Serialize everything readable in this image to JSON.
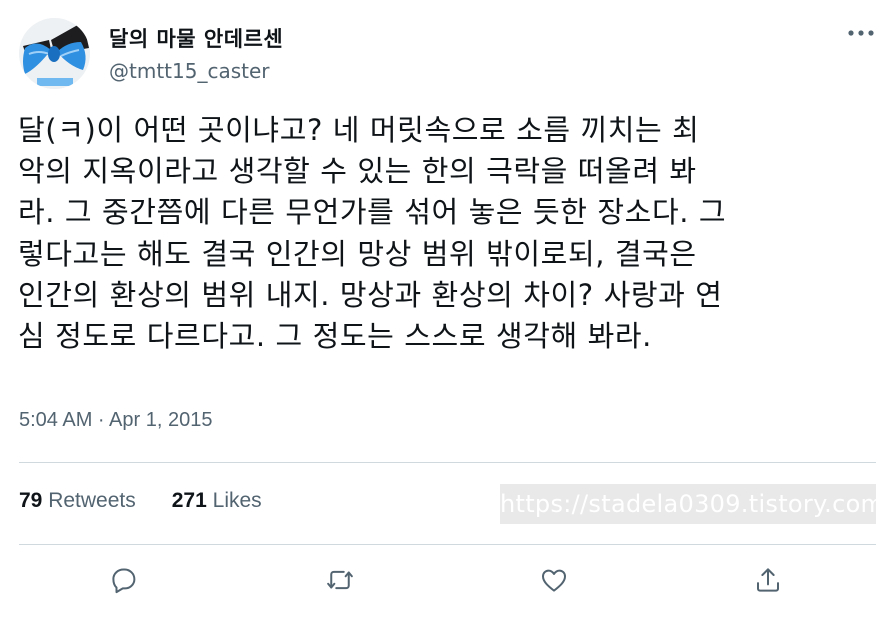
{
  "user": {
    "display_name": "달의 마물 안데르센",
    "handle": "@tmtt15_caster"
  },
  "tweet": {
    "lines": [
      "달(ㅋ)이 어떤 곳이냐고? 네 머릿속으로 소름 끼치는 최",
      "악의 지옥이라고 생각할 수 있는 한의 극락을 떠올려 봐",
      "라. 그 중간쯤에 다른 무언가를 섞어 놓은 듯한 장소다. 그",
      "렇다고는 해도 결국 인간의 망상 범위 밖이로되, 결국은",
      "인간의 환상의 범위 내지. 망상과 환상의 차이? 사랑과 연",
      "심 정도로 다르다고. 그 정도는 스스로 생각해 봐라."
    ],
    "timestamp": "5:04 AM · Apr 1, 2015"
  },
  "stats": {
    "retweets_count": "79",
    "retweets_label": "Retweets",
    "likes_count": "271",
    "likes_label": "Likes"
  },
  "watermark": "https://stadela0309.tistory.com",
  "icons": {
    "more": "more-icon",
    "reply": "reply-icon",
    "retweet": "retweet-icon",
    "like": "like-icon",
    "share": "share-icon"
  },
  "colors": {
    "text": "#0f1419",
    "secondary": "#536471",
    "divider": "#cfd9de",
    "bow_blue": "#2f8fe0"
  }
}
